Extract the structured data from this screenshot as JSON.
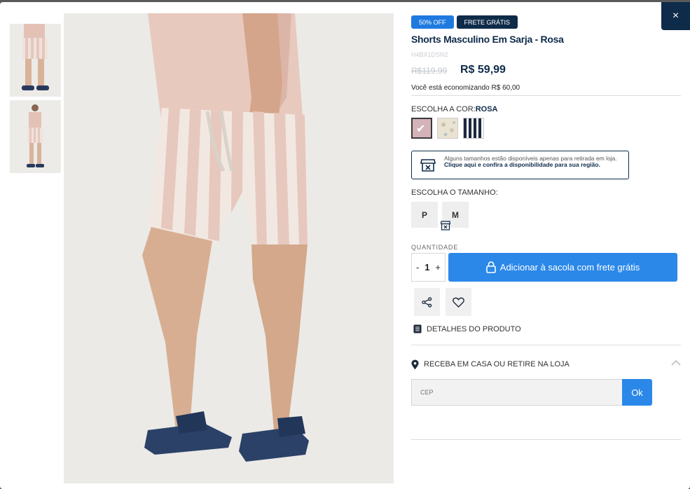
{
  "modal": {
    "close_label": "×"
  },
  "badges": {
    "discount": "50% OFF",
    "shipping": "FRETE GRÁTIS"
  },
  "product": {
    "title": "Shorts Masculino Em Sarja - Rosa",
    "sku": "H4BX1DSN2",
    "old_price": "R$119,99",
    "price": "R$ 59,99",
    "economy": "Você está economizando R$ 60,00"
  },
  "color": {
    "label": "ESCOLHA A COR:",
    "selected": "ROSA",
    "swatches": [
      "rosa",
      "floral",
      "listrado-marinho"
    ]
  },
  "store_notice": {
    "text": "Alguns tamanhos estão disponíveis apenas para retirada em loja.",
    "link": "Clique aqui e confira a disponibilidade para sua região."
  },
  "size": {
    "label": "ESCOLHA O TAMANHO:",
    "options": [
      "P",
      "M"
    ]
  },
  "quantity": {
    "label": "QUANTIDADE",
    "minus": "-",
    "value": "1",
    "plus": "+"
  },
  "cart": {
    "add_label": "Adicionar à sacola com frete grátis"
  },
  "details": {
    "label": "DETALHES DO PRODUTO"
  },
  "delivery": {
    "label": "RECEBA EM CASA OU RETIRE NA LOJA",
    "cep_placeholder": "CEP",
    "ok_label": "Ok"
  },
  "colors": {
    "navy": "#0f2b4a",
    "blue": "#2b88e9",
    "badge_blue": "#1f7ae0"
  },
  "icons": [
    "close-icon",
    "store-icon",
    "lock-bag-icon",
    "share-icon",
    "heart-icon",
    "list-icon",
    "location-pin-icon",
    "chevron-up-icon"
  ]
}
